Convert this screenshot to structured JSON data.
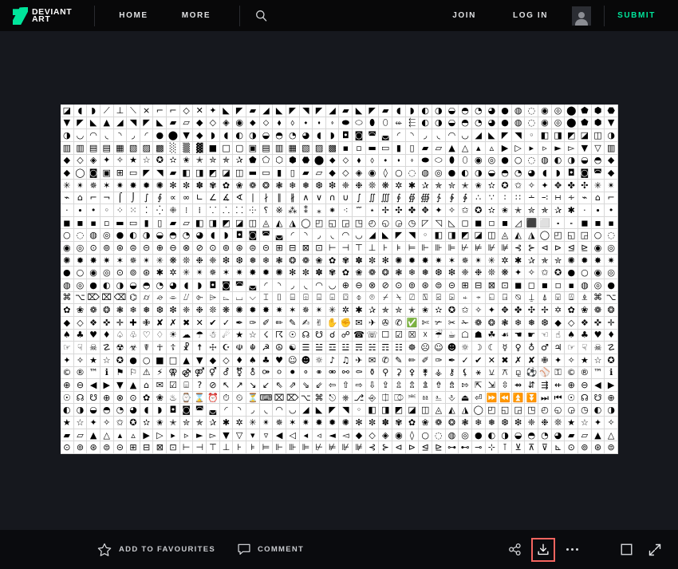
{
  "site": {
    "logo_line1": "DEVIANT",
    "logo_line2": "ART",
    "logo_color": "#00e59b"
  },
  "header": {
    "nav": [
      {
        "label": "HOME",
        "name": "nav-home"
      },
      {
        "label": "MORE",
        "name": "nav-more"
      }
    ],
    "search_icon": "search-icon",
    "auth": [
      {
        "label": "JOIN",
        "name": "join-link"
      },
      {
        "label": "LOG IN",
        "name": "login-link"
      }
    ],
    "avatar_icon": "user-avatar-icon",
    "submit_label": "SUBMIT",
    "submit_color": "#00e59b"
  },
  "viewer": {
    "background": "#16181e",
    "artwork": {
      "name": "artwork-symbol-font-sheet",
      "description": "Dingbat symbol font specimen sheet: dense grid of black glyphs on white",
      "background": "#ffffff",
      "grid_columns": 42,
      "grid_rows": 28,
      "glyph_rows": [
        "◪◖◗⟋⊥⟍⨯⌐⌐◇✕✦◣◤▰◢◣◤◥◤◢▰◣◤▰◖◗◐◑◒◓◔◕●◍◌◉◎⬤⬟⬢⬣",
        "▼◤◣▲◢◥◤◣▰▱◆◇◈◉⬥⬦⬧⬨⬩⬪⬫⬬⬭⬮⬯⬰⬱◐◑◒◓◔◕●◍◌◉◎⬤⬟⬢",
        "◑◡◠◟◝◞◜●⬤▼◆◗◖◐◑◒◓◔◕◖◗◘◙◚◛◜◝◞◟◠◡◢◣◤◥◦◧◨◩◪◫",
        "▥▥▤▤▦▧▨▩░▒▓■□▢▣▤▥▦▧▨▩▪▫▬▭▮▯▰▱▲△▴▵▶▷▸▹►▻▼▽",
        "◆◇◈✦✧★☆✪✫✬✭✮✯✰⬟⬠⬡⬢⬣⬤⬥⬦⬧⬨⬩⬪⬫⬬⬭⬮⬯◉◎●○◌◍◐◑◒◓",
        "◆◯◙▣⊞▭◤◥▰◧◨◩◪◫▬▭▮▯▰▱◆◇◈◉◊○◌◍◎●◐◑◒◓◔◕◖◗◘◙◚",
        "✳✴✵✶✷✸✹✺✻✼✽✾✿❀❁❂❃❄❅❆❇❈❉❊❋✲✱✰✯✮✭✬✫✪✩✧✦✥✤✣",
        "⌁⌂⌐¬⌠⌡∫∮∝∞∟∠∡∢∣∤∥∦∧∨∩∪∫∬∭∮∯∰∱∲∳∴∵∶∷∸∹∺∻",
        "·∙•◦⁘⁙⁚⁛⁜⁝⁞⸪⸫⸬⸭⸮※⁂⁑⁎⁕⁖⁗⋆✢✣✤✥✦✧✩✪✫✬✭✮✯✰✱",
        "◼◾▪▫▬▭▮▯▰▱◧◨◩◪◫◬◭◮◯◰◱◲◳◴◵◶◷◸◹◺◻◼◽◾◿⬛⬜⬝⬞",
        "○◌◍◎●◐◑◒◓◔◕◖◗◘◙◚◛◜◝◞◟◠◡◢◣◤◥◦◧◨◩◪◫◬◭◮◯◰◱◲",
        "◉◎⊙⊚⊛⊜⊝⊕⊖⊗⊘⊙⊚⊛⊜⊝⊞⊟⊠⊡⊢⊣⊤⊥⊦⊧⊨⊩⊪⊫⊬⊭⊮⊯⊰⊱⊲⊳⊴⊵",
        "✺✹✸✷✶✵✴✳❋❊❉❈❇❆❅❄❃❂❁❀✿✾✽✼✻✺✹✸✷✶✵✴✳✲✱✰✯✮",
        "●○◉◎⊙⊚⊛✱✲✳✴✵✶✷✸✹✺✻✼✽✾✿❀❁❂❃❄❅❆❇❈❉❊❋✦✧✩✪",
        "◍◎●◐◑◒◓◔◕◖◗◘◙◚◛◜◝◞◟◠◡⊕⊖⊗⊘⊙⊚⊛⊜⊝⊞⊟⊠⊡◼◻◾◽▪",
        "⌘⌥⌦⌧⌫⌬⌭⌮⌯⌰⌱⌲⌳⌴⌵⌶⌷⌸⌹⌺⌻⌼⌽⌾⌿⍀⍁⍂⍃⍄⍅⍆⍇⍈⍉⍊⍋⍌⍍⍎",
        "✿❀❁❂❃❄❅❆❇❈❉❊❋✺✹✸✷✶✵✴✳✲✱✰✯✮✭✬✫✪✩✧✦✥✤✣✢✡",
        "◆◇❖✜✛✚✙✘✗✖✕✔✓✒✑✐✏✎✍✌✋✊✉✈✇✆✅✄✃✂✁❁❂❃❄❅❆",
        "♠♣♥♦♤♧♡♢☀☁☂☃☄★☆☇☈☉☊☋☌☍☎☏☐☑☒☓☔☕☖☗☘☙☚☛☜☝",
        "☞☟☠☡☢☣☤☥☦☧☨☩☪☫☬☭☮☯☰☱☲☳☴☵☶☷☸☹☺☻☼☽☾☿♀♁♂♃",
        "✦✧★☆✪●○■□▲▼◆◇♦♠♣♥☺☻☼♪♫✈✉✆✎✏✐✑✒✓✔✕✖✗✘✙",
        "©®™ℹ⚑⚐⚠⚡⚢⚣⚤⚥⚦⚧⚨⚩⚪⚫⚬⚭⚮⚯⚰⚱⚲⚳⚴⚵⚶⚷⚸⚹⚺⚻⚼⚽⚾⚿",
        "⊕⊖◀▶▼▲⌂✉☑⌸?⊘↖↗↘↙⇖⇗⇘⇙⇦⇧⇨⇩⇪⇫⇬⇭⇮⇯⇰⇱⇲⇳⇴⇵⇶⇷",
        "☉☊☋⊕⊗⊙✿❀♨⌚⌛⏰⏱⏲⏳⌨⌧⌦⌥⌘⎋⎈⎇⎆⎅⎄⎃⎂⎁⎀⏏⏎⏩⏪⏫⏬⏭⏮",
        "◐◑◒◓◔◕◖◗◘◙◚◛◜◝◞◟◠◡◢◣◤◥◦◧◨◩◪◫◬◭◮◯◰◱◲◳◴◵◶◷",
        "★☆✦✧✩✪✫✬✭✮✯✰✱✲✳✴✵✶✷✸✹✺✻✼✽✾✿❀❁❂❃❄❅❆❇❈❉❊",
        "▰▱▲△▴▵▶▷▸▹►▻▼▽▾▿◀◁◂◃◄◅◆◇◈◉◊○◌◍◎●◐◑◒◓◔◕",
        "⊙⊚⊛⊜⊝⊞⊟⊠⊡⊢⊣⊤⊥⊦⊧⊨⊩⊪⊫⊬⊭⊮⊯⊰⊱⊲⊳⊴⊵⊶⊷⊸⊹⊺⊻⊼⊽⊾"
      ]
    }
  },
  "bottom_bar": {
    "actions": [
      {
        "name": "add-to-favourites-button",
        "icon": "star-icon",
        "label": "ADD TO FAVOURITES"
      },
      {
        "name": "comment-button",
        "icon": "comment-icon",
        "label": "COMMENT"
      }
    ],
    "tools": [
      {
        "name": "share-button",
        "icon": "share-icon",
        "highlighted": false
      },
      {
        "name": "download-button",
        "icon": "download-icon",
        "highlighted": true
      },
      {
        "name": "more-options-button",
        "icon": "ellipsis-icon",
        "highlighted": false
      },
      {
        "name": "fit-to-screen-button",
        "icon": "square-icon",
        "highlighted": false
      },
      {
        "name": "fullscreen-button",
        "icon": "expand-arrows-icon",
        "highlighted": false
      }
    ],
    "highlight_color": "#f4645f"
  }
}
